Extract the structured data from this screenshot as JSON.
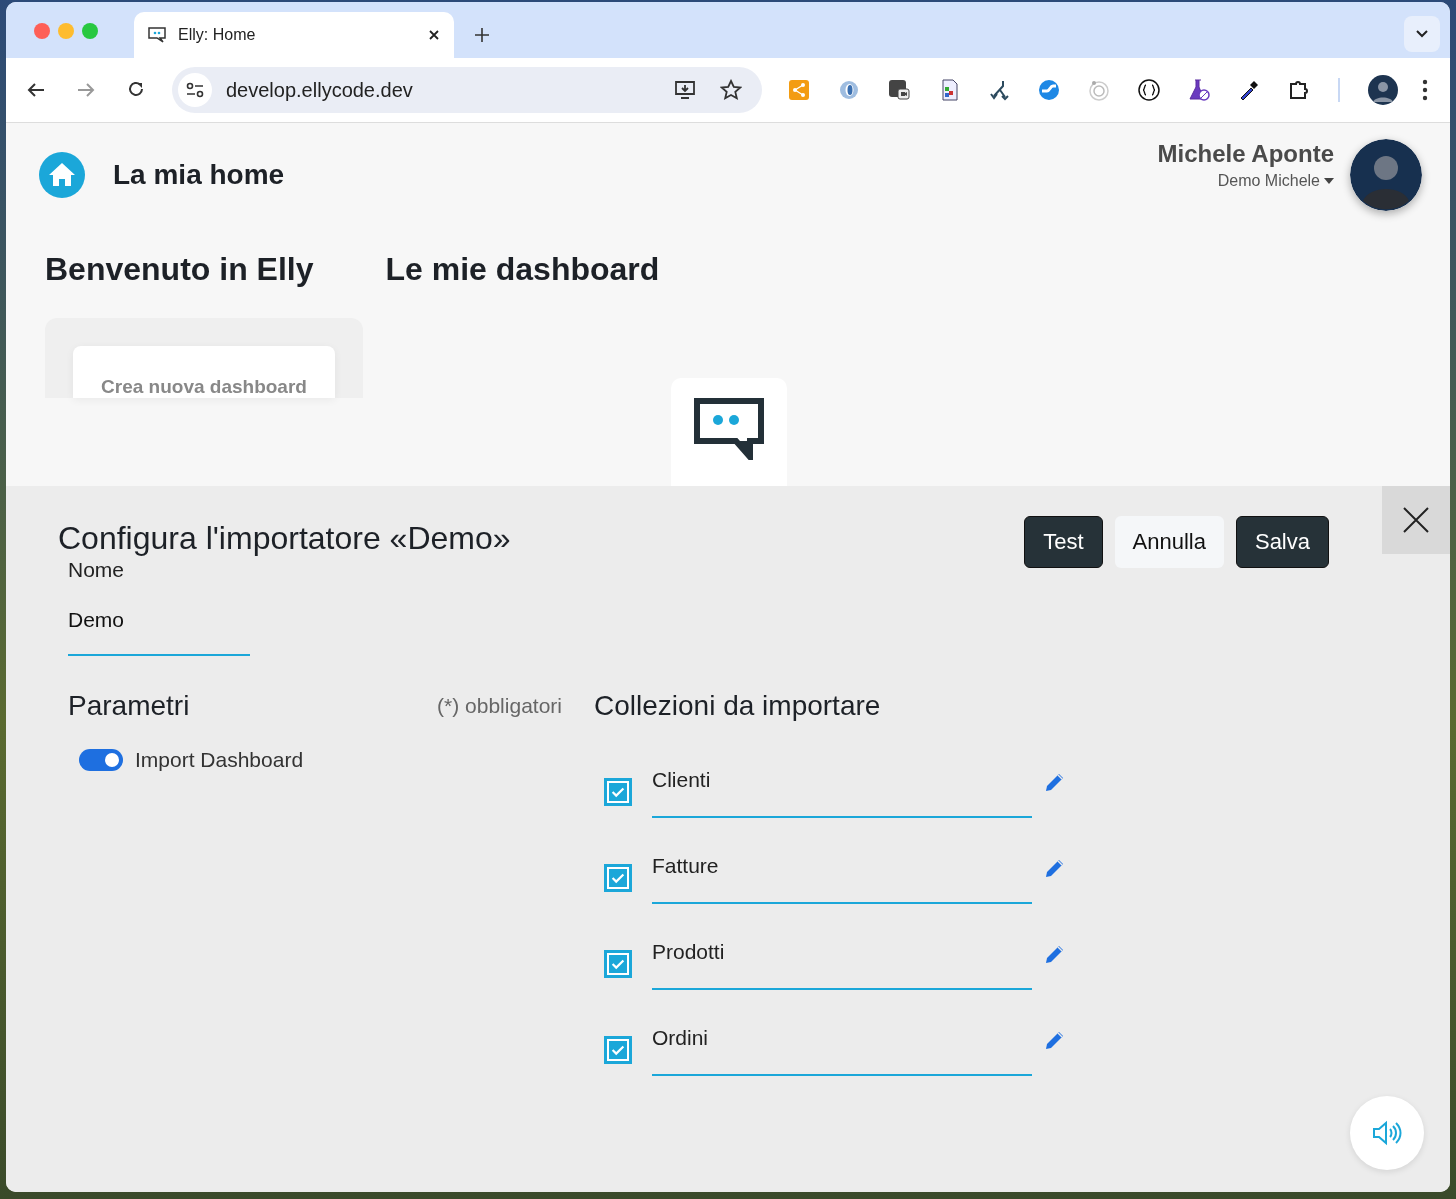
{
  "browser": {
    "tab": {
      "title": "Elly: Home",
      "selected": true
    },
    "address": "develop.ellycode.dev"
  },
  "header": {
    "title": "La mia home",
    "user_name": "Michele Aponte",
    "account": "Demo Michele"
  },
  "sections": {
    "welcome": "Benvenuto in Elly",
    "dashboards": "Le mie dashboard",
    "create_card": "Crea nuova dashboard"
  },
  "panel": {
    "title": "Configura l'importatore «Demo»",
    "buttons": [
      {
        "label": "Test",
        "kind": "dark"
      },
      {
        "label": "Annulla",
        "kind": "light"
      },
      {
        "label": "Salva",
        "kind": "dark"
      }
    ],
    "name_field": {
      "label": "Nome",
      "value": "Demo"
    },
    "parameters": {
      "title": "Parametri",
      "required_note": "(*) obbligatori",
      "toggles": [
        {
          "label": "Import Dashboard",
          "on": true
        }
      ]
    },
    "collections": {
      "title": "Collezioni da importare",
      "items": [
        {
          "name": "Clienti",
          "checked": true
        },
        {
          "name": "Fatture",
          "checked": true
        },
        {
          "name": "Prodotti",
          "checked": true
        },
        {
          "name": "Ordini",
          "checked": true
        }
      ]
    }
  }
}
